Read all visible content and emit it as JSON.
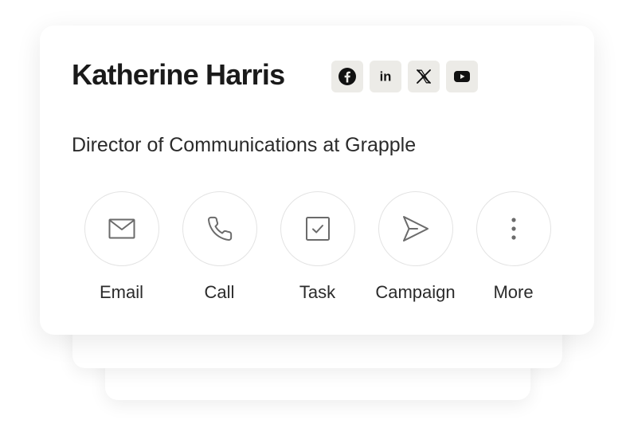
{
  "contact": {
    "name": "Katherine Harris",
    "title": "Director of Communications at Grapple"
  },
  "socials": [
    {
      "name": "facebook-icon"
    },
    {
      "name": "linkedin-icon",
      "label": "in"
    },
    {
      "name": "x-icon"
    },
    {
      "name": "youtube-icon"
    }
  ],
  "actions": [
    {
      "label": "Email",
      "icon": "envelope-icon"
    },
    {
      "label": "Call",
      "icon": "phone-icon"
    },
    {
      "label": "Task",
      "icon": "checkbox-icon"
    },
    {
      "label": "Campaign",
      "icon": "send-icon"
    },
    {
      "label": "More",
      "icon": "more-vertical-icon"
    }
  ],
  "colors": {
    "text_primary": "#1a1a1a",
    "text_secondary": "#2b2b2b",
    "social_bg": "#ecebe7",
    "icon_stroke": "#6b6b6b",
    "circle_border": "#e3e3e3"
  }
}
